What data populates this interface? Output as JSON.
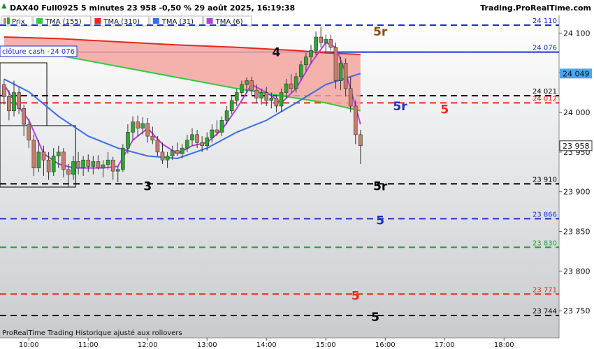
{
  "header": {
    "title": "DAX40 Full0925 5 minutes 23 958 -0,50 % 29 août 2025, 16:19:38",
    "brand": "Trading.ProRealTime.com"
  },
  "legend": [
    {
      "label": "Prix",
      "color": "#c87c6c",
      "icon": "candle-icon"
    },
    {
      "label": "TMA (155)",
      "color": "#2ecc40"
    },
    {
      "label": "TMA (310)",
      "color": "#e8281e"
    },
    {
      "label": "TMA (31)",
      "color": "#3a6ee8"
    },
    {
      "label": "TMA (6)",
      "color": "#b43fe0"
    }
  ],
  "cash_close": {
    "label": "clôture cash -",
    "value": "24 076"
  },
  "footer": "ProRealTime Trading  Historique ajusté aux rollovers",
  "levels": [
    {
      "value": 24110,
      "label": "24 110",
      "color": "#1a2fd0",
      "style": "dashed"
    },
    {
      "value": 24076,
      "label": "24 076",
      "color": "#1a2fd0",
      "style": "solid"
    },
    {
      "value": 24021,
      "label": "24 021",
      "color": "#000000",
      "style": "dashed"
    },
    {
      "value": 24012,
      "label": "24 012",
      "color": "#e8281e",
      "style": "dashed"
    },
    {
      "value": 23910,
      "label": "23 910",
      "color": "#000000",
      "style": "dashed"
    },
    {
      "value": 23866,
      "label": "23 866",
      "color": "#1a2fd0",
      "style": "dashed"
    },
    {
      "value": 23830,
      "label": "23 830",
      "color": "#2ca02c",
      "style": "dashed"
    },
    {
      "value": 23771,
      "label": "23 771",
      "color": "#e8281e",
      "style": "dashed"
    },
    {
      "value": 23744,
      "label": "23 744",
      "color": "#000000",
      "style": "dashed"
    }
  ],
  "wave_labels": [
    {
      "text": "5r",
      "time": "15:55",
      "price": 24103,
      "color": "#8b4a10"
    },
    {
      "text": "4",
      "time": "14:10",
      "price": 24077,
      "color": "#000000"
    },
    {
      "text": "5r",
      "time": "16:15",
      "price": 24009,
      "color": "#1a2fd0"
    },
    {
      "text": "5",
      "time": "17:00",
      "price": 24005,
      "color": "#e8281e"
    },
    {
      "text": "3",
      "time": "12:00",
      "price": 23908,
      "color": "#000000"
    },
    {
      "text": "5r",
      "time": "15:55",
      "price": 23908,
      "color": "#000000"
    },
    {
      "text": "5",
      "time": "15:55",
      "price": 23865,
      "color": "#1a2fd0"
    },
    {
      "text": "5",
      "time": "15:30",
      "price": 23770,
      "color": "#e8281e"
    },
    {
      "text": "5",
      "time": "15:50",
      "price": 23743,
      "color": "#000000"
    }
  ],
  "current_price": {
    "label": "23 958",
    "value": 23958
  },
  "tma31_value": {
    "label": "24 049",
    "value": 24049
  },
  "chart_data": {
    "type": "candlestick",
    "title": "DAX40 Full0925 5 minutes",
    "x_ticks": [
      "10:00",
      "11:00",
      "12:00",
      "13:00",
      "14:00",
      "15:00",
      "16:00",
      "17:00",
      "18:00"
    ],
    "xlim": [
      "09:35",
      "18:35"
    ],
    "y_ticks": [
      24100,
      24050,
      24000,
      23950,
      23900,
      23850,
      23800,
      23750
    ],
    "y_tick_labels": [
      "24 100",
      "24 050",
      "24 000",
      "23 950",
      "23 900",
      "23 850",
      "23 800",
      "23 750"
    ],
    "ylim": [
      23725,
      24140
    ],
    "candles": [
      {
        "t": "09:35",
        "o": 24035,
        "h": 24042,
        "l": 24010,
        "c": 24020
      },
      {
        "t": "09:40",
        "o": 24020,
        "h": 24028,
        "l": 23990,
        "c": 24002
      },
      {
        "t": "09:45",
        "o": 24002,
        "h": 24040,
        "l": 23995,
        "c": 24025
      },
      {
        "t": "09:50",
        "o": 24025,
        "h": 24032,
        "l": 23998,
        "c": 24005
      },
      {
        "t": "09:55",
        "o": 24005,
        "h": 24010,
        "l": 23970,
        "c": 23985
      },
      {
        "t": "10:00",
        "o": 23985,
        "h": 23992,
        "l": 23955,
        "c": 23965
      },
      {
        "t": "10:05",
        "o": 23965,
        "h": 23972,
        "l": 23920,
        "c": 23930
      },
      {
        "t": "10:10",
        "o": 23930,
        "h": 23965,
        "l": 23925,
        "c": 23950
      },
      {
        "t": "10:15",
        "o": 23950,
        "h": 23958,
        "l": 23920,
        "c": 23940
      },
      {
        "t": "10:20",
        "o": 23940,
        "h": 23950,
        "l": 23915,
        "c": 23925
      },
      {
        "t": "10:25",
        "o": 23925,
        "h": 23955,
        "l": 23920,
        "c": 23945
      },
      {
        "t": "10:30",
        "o": 23945,
        "h": 23958,
        "l": 23930,
        "c": 23950
      },
      {
        "t": "10:35",
        "o": 23950,
        "h": 23955,
        "l": 23918,
        "c": 23928
      },
      {
        "t": "10:40",
        "o": 23928,
        "h": 23935,
        "l": 23906,
        "c": 23922
      },
      {
        "t": "10:45",
        "o": 23922,
        "h": 23945,
        "l": 23915,
        "c": 23938
      },
      {
        "t": "10:50",
        "o": 23938,
        "h": 23950,
        "l": 23922,
        "c": 23930
      },
      {
        "t": "10:55",
        "o": 23930,
        "h": 23945,
        "l": 23920,
        "c": 23940
      },
      {
        "t": "11:00",
        "o": 23940,
        "h": 23947,
        "l": 23925,
        "c": 23932
      },
      {
        "t": "11:05",
        "o": 23932,
        "h": 23945,
        "l": 23922,
        "c": 23938
      },
      {
        "t": "11:10",
        "o": 23938,
        "h": 23946,
        "l": 23928,
        "c": 23930
      },
      {
        "t": "11:15",
        "o": 23930,
        "h": 23940,
        "l": 23918,
        "c": 23934
      },
      {
        "t": "11:20",
        "o": 23934,
        "h": 23950,
        "l": 23928,
        "c": 23940
      },
      {
        "t": "11:25",
        "o": 23940,
        "h": 23944,
        "l": 23915,
        "c": 23926
      },
      {
        "t": "11:30",
        "o": 23926,
        "h": 23932,
        "l": 23912,
        "c": 23928
      },
      {
        "t": "11:35",
        "o": 23928,
        "h": 23960,
        "l": 23925,
        "c": 23955
      },
      {
        "t": "11:40",
        "o": 23955,
        "h": 23985,
        "l": 23948,
        "c": 23975
      },
      {
        "t": "11:45",
        "o": 23975,
        "h": 23995,
        "l": 23965,
        "c": 23988
      },
      {
        "t": "11:50",
        "o": 23988,
        "h": 23996,
        "l": 23970,
        "c": 23980
      },
      {
        "t": "11:55",
        "o": 23980,
        "h": 23994,
        "l": 23972,
        "c": 23986
      },
      {
        "t": "12:00",
        "o": 23986,
        "h": 23993,
        "l": 23962,
        "c": 23970
      },
      {
        "t": "12:05",
        "o": 23970,
        "h": 23982,
        "l": 23960,
        "c": 23965
      },
      {
        "t": "12:10",
        "o": 23965,
        "h": 23970,
        "l": 23945,
        "c": 23950
      },
      {
        "t": "12:15",
        "o": 23950,
        "h": 23962,
        "l": 23935,
        "c": 23940
      },
      {
        "t": "12:20",
        "o": 23940,
        "h": 23950,
        "l": 23930,
        "c": 23945
      },
      {
        "t": "12:25",
        "o": 23945,
        "h": 23958,
        "l": 23940,
        "c": 23952
      },
      {
        "t": "12:30",
        "o": 23952,
        "h": 23962,
        "l": 23945,
        "c": 23948
      },
      {
        "t": "12:35",
        "o": 23948,
        "h": 23960,
        "l": 23942,
        "c": 23955
      },
      {
        "t": "12:40",
        "o": 23955,
        "h": 23972,
        "l": 23950,
        "c": 23965
      },
      {
        "t": "12:45",
        "o": 23965,
        "h": 23980,
        "l": 23958,
        "c": 23972
      },
      {
        "t": "12:50",
        "o": 23972,
        "h": 23978,
        "l": 23955,
        "c": 23962
      },
      {
        "t": "12:55",
        "o": 23962,
        "h": 23970,
        "l": 23950,
        "c": 23958
      },
      {
        "t": "13:00",
        "o": 23958,
        "h": 23975,
        "l": 23952,
        "c": 23968
      },
      {
        "t": "13:05",
        "o": 23968,
        "h": 23985,
        "l": 23962,
        "c": 23978
      },
      {
        "t": "13:10",
        "o": 23978,
        "h": 23990,
        "l": 23970,
        "c": 23975
      },
      {
        "t": "13:15",
        "o": 23975,
        "h": 23995,
        "l": 23970,
        "c": 23990
      },
      {
        "t": "13:20",
        "o": 23990,
        "h": 24008,
        "l": 23985,
        "c": 24002
      },
      {
        "t": "13:25",
        "o": 24002,
        "h": 24020,
        "l": 23998,
        "c": 24015
      },
      {
        "t": "13:30",
        "o": 24015,
        "h": 24030,
        "l": 24008,
        "c": 24025
      },
      {
        "t": "13:35",
        "o": 24025,
        "h": 24040,
        "l": 24020,
        "c": 24035
      },
      {
        "t": "13:40",
        "o": 24035,
        "h": 24044,
        "l": 24025,
        "c": 24040
      },
      {
        "t": "13:45",
        "o": 24040,
        "h": 24045,
        "l": 24022,
        "c": 24028
      },
      {
        "t": "13:50",
        "o": 24028,
        "h": 24035,
        "l": 24012,
        "c": 24018
      },
      {
        "t": "13:55",
        "o": 24018,
        "h": 24030,
        "l": 24010,
        "c": 24025
      },
      {
        "t": "14:00",
        "o": 24025,
        "h": 24032,
        "l": 24008,
        "c": 24015
      },
      {
        "t": "14:05",
        "o": 24015,
        "h": 24025,
        "l": 24005,
        "c": 24018
      },
      {
        "t": "14:10",
        "o": 24018,
        "h": 24022,
        "l": 24000,
        "c": 24008
      },
      {
        "t": "14:15",
        "o": 24008,
        "h": 24030,
        "l": 24000,
        "c": 24025
      },
      {
        "t": "14:20",
        "o": 24025,
        "h": 24042,
        "l": 24018,
        "c": 24036
      },
      {
        "t": "14:25",
        "o": 24036,
        "h": 24048,
        "l": 24025,
        "c": 24030
      },
      {
        "t": "14:30",
        "o": 24030,
        "h": 24050,
        "l": 24025,
        "c": 24045
      },
      {
        "t": "14:35",
        "o": 24045,
        "h": 24065,
        "l": 24040,
        "c": 24060
      },
      {
        "t": "14:40",
        "o": 24060,
        "h": 24075,
        "l": 24052,
        "c": 24070
      },
      {
        "t": "14:45",
        "o": 24070,
        "h": 24085,
        "l": 24062,
        "c": 24078
      },
      {
        "t": "14:50",
        "o": 24078,
        "h": 24102,
        "l": 24072,
        "c": 24095
      },
      {
        "t": "14:55",
        "o": 24095,
        "h": 24108,
        "l": 24082,
        "c": 24088
      },
      {
        "t": "15:00",
        "o": 24088,
        "h": 24098,
        "l": 24075,
        "c": 24092
      },
      {
        "t": "15:05",
        "o": 24092,
        "h": 24098,
        "l": 24078,
        "c": 24082
      },
      {
        "t": "15:10",
        "o": 24082,
        "h": 24088,
        "l": 24030,
        "c": 24040
      },
      {
        "t": "15:15",
        "o": 24040,
        "h": 24070,
        "l": 24028,
        "c": 24062
      },
      {
        "t": "15:20",
        "o": 24062,
        "h": 24068,
        "l": 24020,
        "c": 24030
      },
      {
        "t": "15:25",
        "o": 24030,
        "h": 24045,
        "l": 24000,
        "c": 24008
      },
      {
        "t": "15:30",
        "o": 24008,
        "h": 24015,
        "l": 23960,
        "c": 23972
      },
      {
        "t": "15:35",
        "o": 23972,
        "h": 23978,
        "l": 23935,
        "c": 23958
      }
    ],
    "series": [
      {
        "name": "TMA (155)",
        "color": "#2ecc40",
        "points": [
          [
            "09:35",
            24082
          ],
          [
            "10:30",
            24072
          ],
          [
            "11:30",
            24058
          ],
          [
            "12:30",
            24044
          ],
          [
            "13:30",
            24030
          ],
          [
            "14:30",
            24018
          ],
          [
            "15:00",
            24012
          ],
          [
            "15:35",
            24002
          ]
        ]
      },
      {
        "name": "TMA (310)",
        "color": "#e8281e",
        "points": [
          [
            "09:35",
            24095
          ],
          [
            "10:30",
            24093
          ],
          [
            "11:30",
            24089
          ],
          [
            "12:30",
            24085
          ],
          [
            "13:30",
            24082
          ],
          [
            "14:30",
            24078
          ],
          [
            "15:00",
            24075
          ],
          [
            "15:35",
            24073
          ]
        ]
      },
      {
        "name": "TMA (31)",
        "color": "#3a6ee8",
        "points": [
          [
            "09:35",
            24042
          ],
          [
            "10:00",
            24026
          ],
          [
            "10:30",
            23995
          ],
          [
            "11:00",
            23970
          ],
          [
            "11:30",
            23955
          ],
          [
            "12:00",
            23945
          ],
          [
            "12:30",
            23942
          ],
          [
            "13:00",
            23955
          ],
          [
            "13:30",
            23975
          ],
          [
            "14:00",
            23990
          ],
          [
            "14:30",
            24012
          ],
          [
            "15:00",
            24035
          ],
          [
            "15:35",
            24049
          ]
        ]
      },
      {
        "name": "TMA (6)",
        "color": "#b43fe0",
        "points": [
          [
            "09:35",
            24035
          ],
          [
            "09:45",
            24015
          ],
          [
            "10:00",
            23990
          ],
          [
            "10:15",
            23948
          ],
          [
            "10:30",
            23935
          ],
          [
            "10:45",
            23930
          ],
          [
            "11:00",
            23930
          ],
          [
            "11:15",
            23930
          ],
          [
            "11:30",
            23932
          ],
          [
            "11:45",
            23965
          ],
          [
            "12:00",
            23980
          ],
          [
            "12:15",
            23960
          ],
          [
            "12:30",
            23948
          ],
          [
            "12:45",
            23958
          ],
          [
            "13:00",
            23962
          ],
          [
            "13:15",
            23978
          ],
          [
            "13:30",
            24005
          ],
          [
            "13:45",
            24035
          ],
          [
            "14:00",
            24025
          ],
          [
            "14:15",
            24012
          ],
          [
            "14:30",
            24030
          ],
          [
            "14:45",
            24062
          ],
          [
            "15:00",
            24088
          ],
          [
            "15:10",
            24082
          ],
          [
            "15:20",
            24050
          ],
          [
            "15:30",
            24008
          ],
          [
            "15:35",
            23985
          ]
        ]
      }
    ]
  }
}
